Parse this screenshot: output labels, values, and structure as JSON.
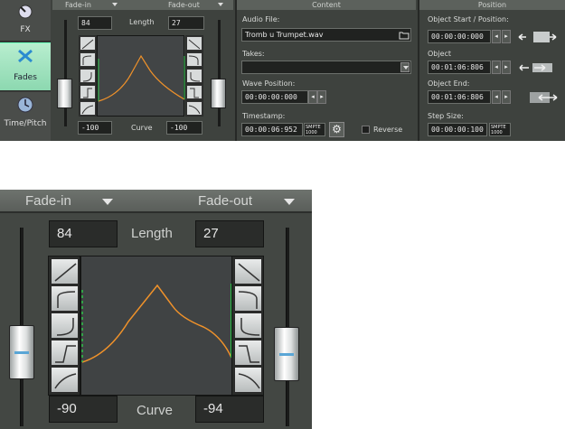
{
  "top": {
    "sidebar": {
      "fx": "FX",
      "fades": "Fades",
      "time": "Time/Pitch"
    },
    "headers": {
      "fade_in": "Fade-in",
      "fade_out": "Fade-out",
      "content": "Content",
      "position": "Position"
    },
    "fades": {
      "length_label": "Length",
      "fade_in_length": "84",
      "fade_out_length": "27",
      "curve_label": "Curve",
      "fade_in_curve": "-100",
      "fade_out_curve": "-100"
    },
    "content": {
      "audio_file_label": "Audio File:",
      "audio_file_value": "Tromb u Trumpet.wav",
      "takes_label": "Takes:",
      "wave_position_label": "Wave Position:",
      "wave_position_value": "00:00:00:000",
      "timestamp_label": "Timestamp:",
      "timestamp_value": "00:00:06:952",
      "timestamp_unit": "SMPTE 1000",
      "reverse_label": "Reverse"
    },
    "position": {
      "object_start_label": "Object Start / Position:",
      "object_start_value": "00:00:00:000",
      "object_label": "Object",
      "object_value": "00:01:06:806",
      "object_end_label": "Object End:",
      "object_end_value": "00:01:06:806",
      "step_size_label": "Step Size:",
      "step_size_value": "00:00:00:100",
      "step_size_unit": "SMPTE 1000"
    }
  },
  "zoom": {
    "fade_in_label": "Fade-in",
    "fade_out_label": "Fade-out",
    "length_label": "Length",
    "fade_in_length": "84",
    "fade_out_length": "27",
    "curve_label": "Curve",
    "fade_in_curve": "-90",
    "fade_out_curve": "-94",
    "curve_color": "#f0922a",
    "marker_color": "#2ec24a"
  }
}
